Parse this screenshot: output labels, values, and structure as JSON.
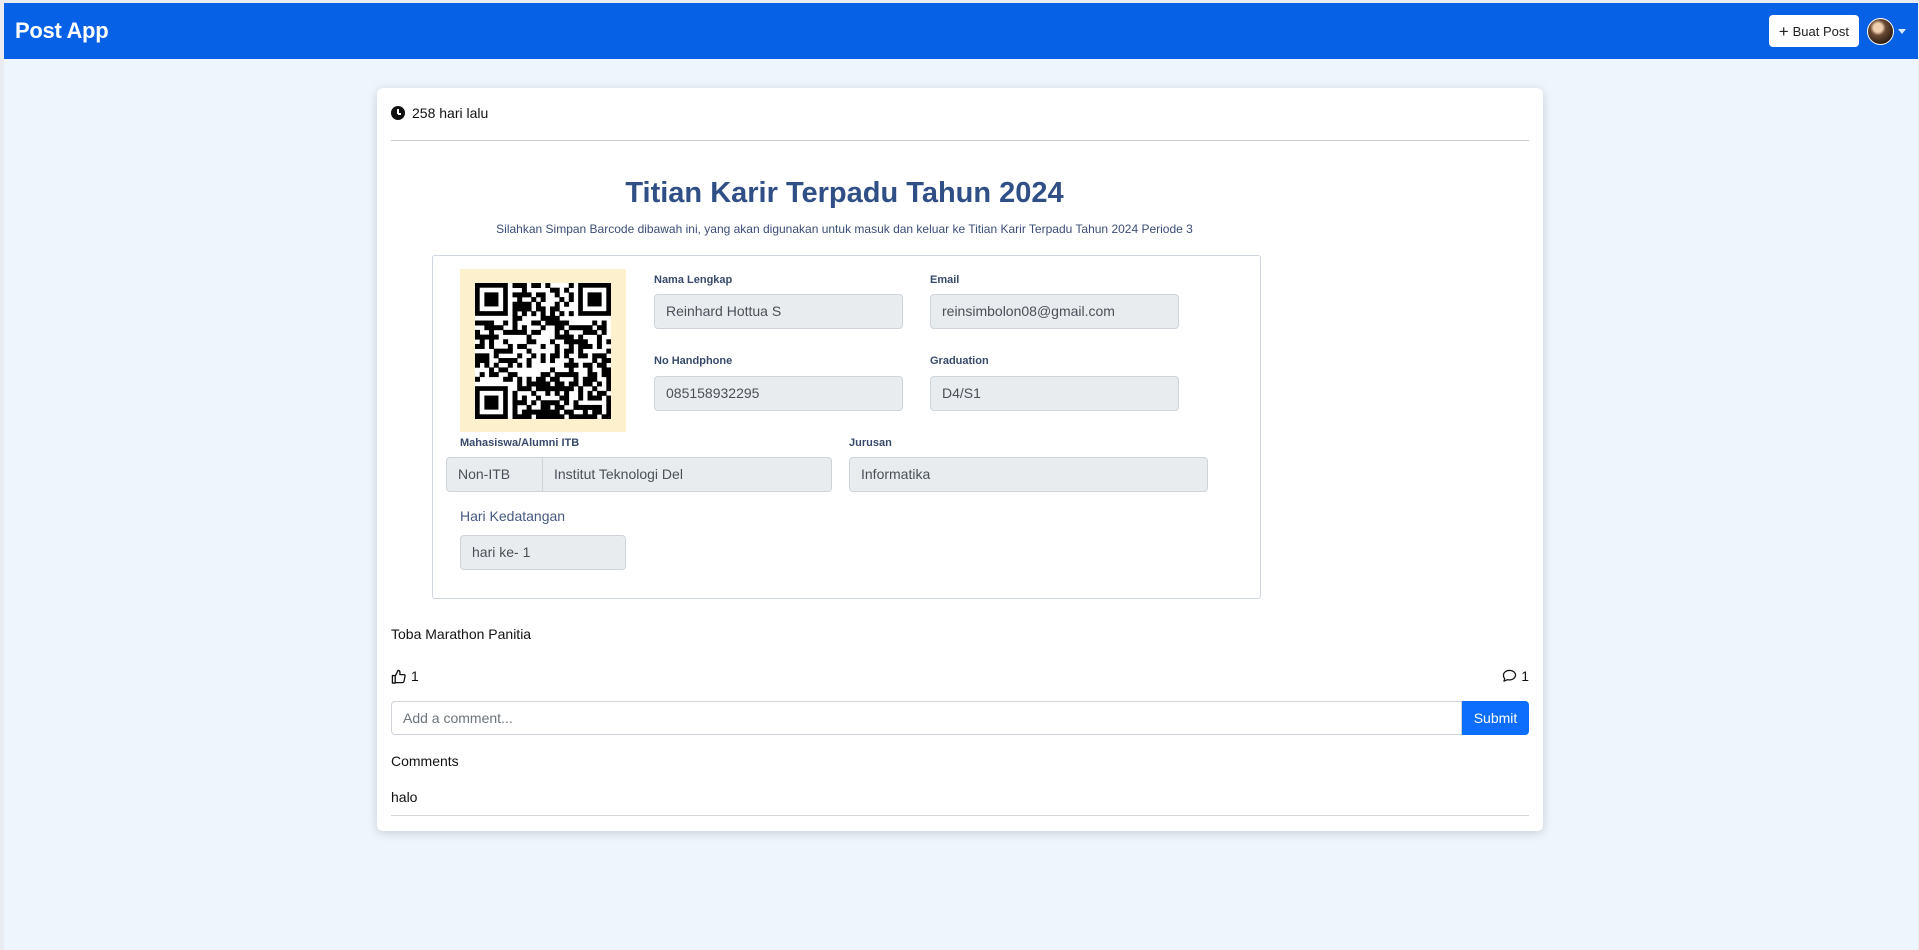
{
  "navbar": {
    "brand": "Post App",
    "create_label": "Buat Post",
    "plus_icon": "plus-icon",
    "avatar_icon": "user-avatar",
    "bg_color": "#0661e6"
  },
  "post": {
    "time_ago": "258 hari lalu",
    "ticket": {
      "title": "Titian Karir Terpadu Tahun 2024",
      "subtitle": "Silahkan Simpan Barcode dibawah ini, yang akan digunakan untuk masuk dan keluar ke Titian Karir Terpadu Tahun 2024 Periode 3",
      "fields": {
        "name_label": "Nama Lengkap",
        "name_value": "Reinhard Hottua S",
        "email_label": "Email",
        "email_value": "reinsimbolon08@gmail.com",
        "phone_label": "No Handphone",
        "phone_value": "085158932295",
        "graduation_label": "Graduation",
        "graduation_value": "D4/S1",
        "student_label": "Mahasiswa/Alumni ITB",
        "student_type": "Non-ITB",
        "institution": "Institut Teknologi Del",
        "major_label": "Jurusan",
        "major_value": "Informatika",
        "arrival_label": "Hari Kedatangan",
        "arrival_value": "hari ke- 1"
      }
    },
    "caption": "Toba Marathon Panitia",
    "likes": "1",
    "comments_count": "1",
    "comment_placeholder": "Add a comment...",
    "submit_label": "Submit",
    "comments_title": "Comments",
    "comments": [
      "halo"
    ]
  }
}
